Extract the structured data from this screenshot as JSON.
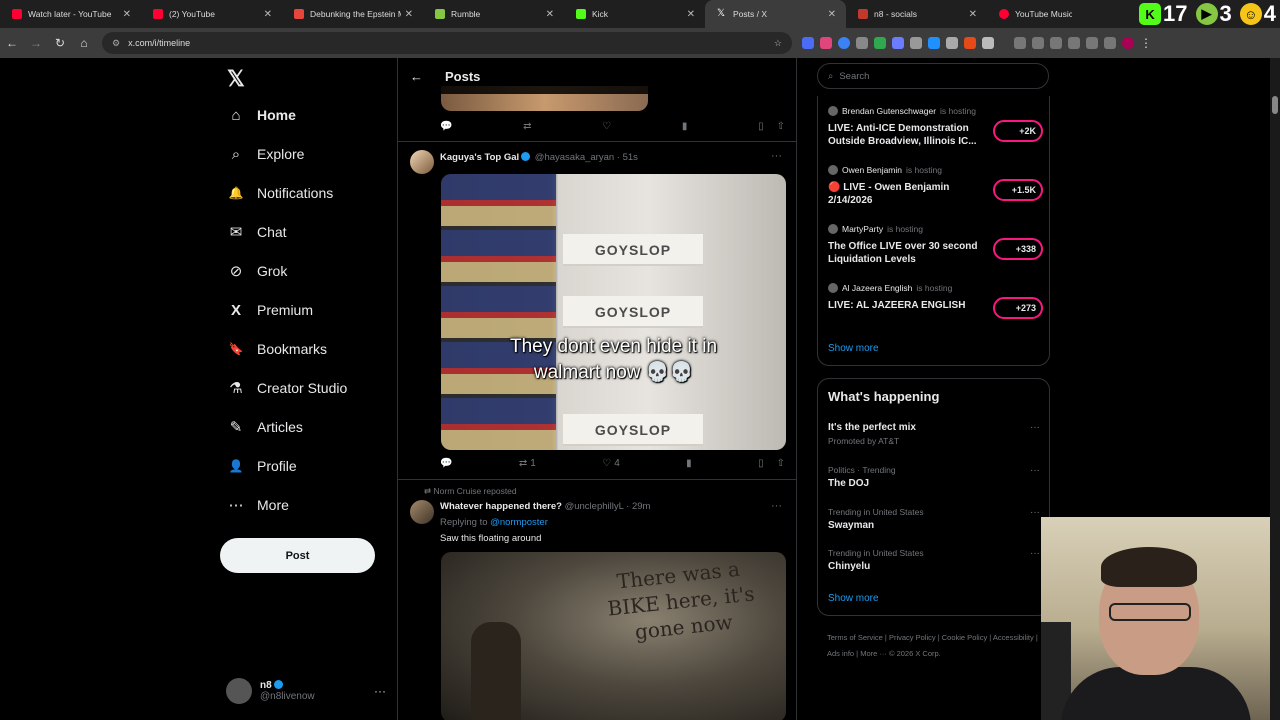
{
  "browser": {
    "tabs": [
      {
        "title": "Watch later - YouTube",
        "color": "#ff0033"
      },
      {
        "title": "(2) YouTube",
        "color": "#ff0033"
      },
      {
        "title": "Debunking the Epstein My",
        "color": "#e8453c"
      },
      {
        "title": "Rumble",
        "color": "#85c742"
      },
      {
        "title": "Kick",
        "color": "#53fc18"
      },
      {
        "title": "Posts / X",
        "color": "#ffffff"
      },
      {
        "title": "n8 - socials",
        "color": "#c0392b"
      },
      {
        "title": "YouTube Music",
        "color": "#ff0033"
      }
    ],
    "url": "x.com/i/timeline",
    "overlay": [
      {
        "label": "17",
        "color": "#53fc18",
        "letter": "K"
      },
      {
        "label": "3",
        "color": "#85c742",
        "letter": "▶"
      },
      {
        "label": "4",
        "color": "#f5c518",
        "letter": "☺"
      }
    ]
  },
  "nav": {
    "items": [
      {
        "label": "Home",
        "icon": "⌂"
      },
      {
        "label": "Explore",
        "icon": "⌕"
      },
      {
        "label": "Notifications",
        "icon": "🔔"
      },
      {
        "label": "Chat",
        "icon": "✉"
      },
      {
        "label": "Grok",
        "icon": "⊘"
      },
      {
        "label": "Premium",
        "icon": "X"
      },
      {
        "label": "Bookmarks",
        "icon": "🔖"
      },
      {
        "label": "Creator Studio",
        "icon": "⚗"
      },
      {
        "label": "Articles",
        "icon": "✎"
      },
      {
        "label": "Profile",
        "icon": "👤"
      },
      {
        "label": "More",
        "icon": "⋯"
      }
    ],
    "post_label": "Post",
    "account": {
      "name": "n8",
      "handle": "@n8livenow"
    }
  },
  "timeline": {
    "title": "Posts",
    "post1": {
      "name": "Kaguya's Top Gal",
      "handle": "@hayasaka_aryan",
      "time": "· 51s",
      "box_label": "GOYSLOP",
      "caption_line1": "They dont even hide it in",
      "caption_line2": "walmart now 💀💀",
      "retweets": "1",
      "likes": "4"
    },
    "post2": {
      "repost": "Norm Cruise reposted",
      "name": "Whatever happened there?",
      "handle": "@unclephillyL",
      "time": "· 29m",
      "replying": "Replying to",
      "replying_to": "@normposter",
      "text": "Saw this floating around",
      "wall_text": "There was a BIKE here, it's gone now"
    }
  },
  "sidebar": {
    "search_placeholder": "Search",
    "live": [
      {
        "host": "Brendan Gutenschwager",
        "title": "LIVE: Anti-ICE Demonstration Outside Broadview, Illinois IC...",
        "count": "+2K"
      },
      {
        "host": "Owen Benjamin",
        "title": "🔴 LIVE - Owen Benjamin 2/14/2026",
        "count": "+1.5K"
      },
      {
        "host": "MartyParty",
        "title": "The Office LIVE over 30 second Liquidation Levels",
        "count": "+338"
      },
      {
        "host": "Al Jazeera English",
        "title": "LIVE: AL JAZEERA ENGLISH",
        "count": "+273"
      }
    ],
    "is_hosting": "is hosting",
    "show_more": "Show more",
    "happening_title": "What's happening",
    "trends": [
      {
        "context": "It's the perfect mix",
        "name": "Promoted by AT&T"
      },
      {
        "context": "Politics · Trending",
        "name": "The DOJ"
      },
      {
        "context": "Trending in United States",
        "name": "Swayman"
      },
      {
        "context": "Trending in United States",
        "name": "Chinyelu"
      }
    ],
    "footer": "Terms of Service  |  Privacy Policy  |  Cookie Policy  |  Accessibility  |  Ads info  |  More ···  © 2026 X Corp."
  }
}
